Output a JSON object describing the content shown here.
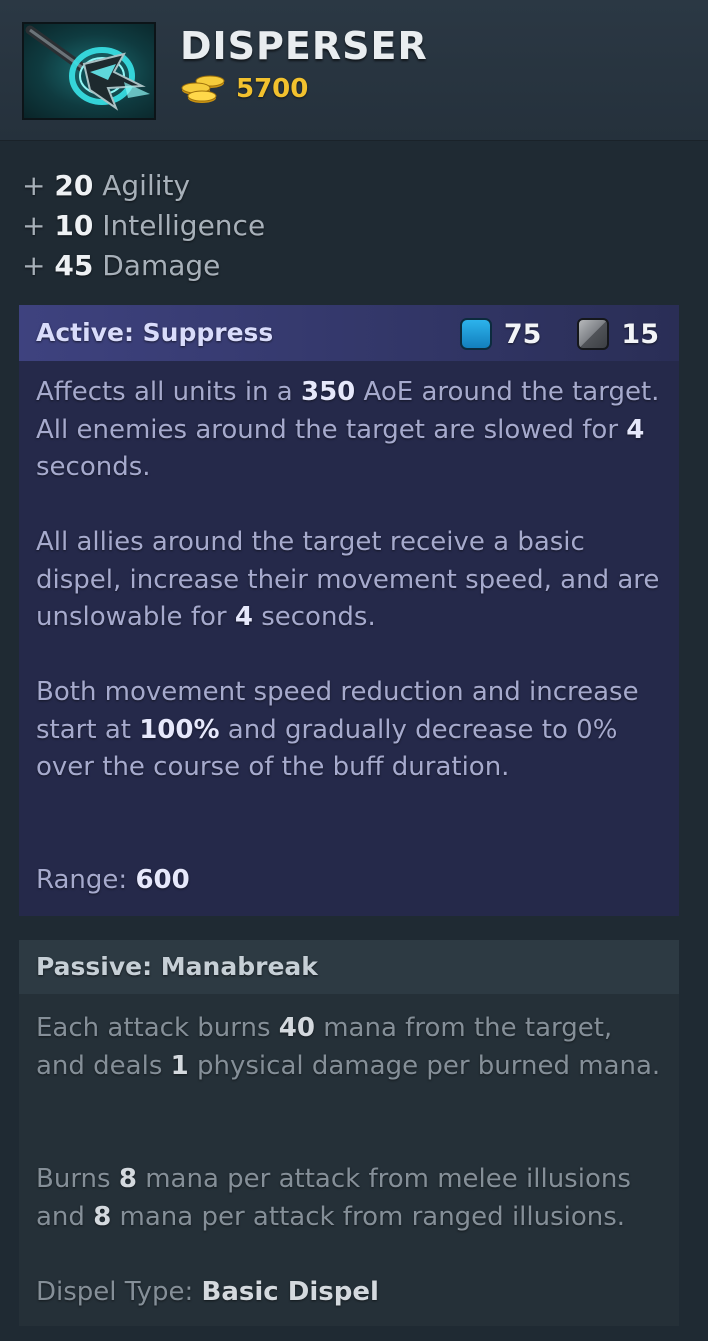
{
  "item": {
    "name": "DISPERSER",
    "cost": "5700",
    "icon": "disperser-item-icon",
    "gold_icon": "gold-coins-icon"
  },
  "stats": [
    {
      "prefix": "+",
      "value": "20",
      "label": "Agility"
    },
    {
      "prefix": "+",
      "value": "10",
      "label": "Intelligence"
    },
    {
      "prefix": "+",
      "value": "45",
      "label": "Damage"
    }
  ],
  "active": {
    "title": "Active: Suppress",
    "mana_cost": "75",
    "cooldown": "15",
    "mana_icon": "mana-cost-icon",
    "cooldown_icon": "cooldown-icon",
    "p1": {
      "a": "Affects all units in a ",
      "b": "350",
      "c": " AoE around the target. All enemies around the target are slowed for ",
      "d": "4",
      "e": " seconds."
    },
    "p2": {
      "a": "All allies around the target receive a basic dispel, increase their movement speed, and are unslowable for ",
      "b": "4",
      "c": " seconds."
    },
    "p3": {
      "a": "Both movement speed reduction and increase start at ",
      "b": "100%",
      "c": " and gradually decrease to 0% over the course of the buff duration."
    },
    "p4": {
      "a": "Range: ",
      "b": "600"
    }
  },
  "passive": {
    "title": "Passive: Manabreak",
    "p1": {
      "a": "Each attack burns ",
      "b": "40",
      "c": " mana from the target, and deals ",
      "d": "1",
      "e": " physical damage per burned mana."
    },
    "p2": {
      "a": "Burns ",
      "b": "8",
      "c": " mana per attack from melee illusions and ",
      "d": "8",
      "e": " mana per attack from ranged illusions."
    },
    "p3": {
      "a": "Dispel Type: ",
      "b": "Basic Dispel"
    }
  },
  "colors": {
    "gold": "#f2c12e",
    "active_header": "#3e427f",
    "active_body": "#25294a",
    "passive_body": "#253038",
    "mana": "#2cb3ec"
  }
}
